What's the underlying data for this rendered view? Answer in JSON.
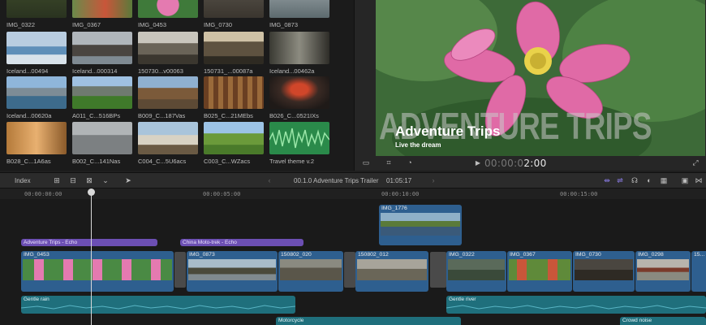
{
  "browser": {
    "clips": [
      {
        "label": "IMG_0322"
      },
      {
        "label": "IMG_0367"
      },
      {
        "label": "IMG_0453"
      },
      {
        "label": "IMG_0730"
      },
      {
        "label": "IMG_0873"
      },
      {
        "label": "Iceland...00494"
      },
      {
        "label": "Iceland...000314"
      },
      {
        "label": "150730...v00063"
      },
      {
        "label": "150731_...00087a"
      },
      {
        "label": "Iceland...00462a"
      },
      {
        "label": "Iceland...00620a"
      },
      {
        "label": "A011_C...516BPs"
      },
      {
        "label": "B009_C...187Vas"
      },
      {
        "label": "B025_C...21MEbs"
      },
      {
        "label": "B026_C...0521IXs"
      },
      {
        "label": "B028_C...1A6as"
      },
      {
        "label": "B002_C...141Nas"
      },
      {
        "label": "C004_C...5U6acs"
      },
      {
        "label": "C003_C...WZacs"
      },
      {
        "label": "Travel theme v.2"
      }
    ]
  },
  "viewer": {
    "title_text": "Adventure Trips",
    "subtitle_text": "Live the dream",
    "watermark_text": "ADVENTURE TRIPS",
    "timecode_dim": "00:00:0",
    "timecode_bright": "2:00",
    "play_glyph": "▶"
  },
  "toolbar": {
    "index_label": "Index",
    "project_title": "00.1.0 Adventure Trips Trailer",
    "duration": "01:05:17"
  },
  "timeline": {
    "ruler": [
      "00:00:00:00",
      "00:00:05:00",
      "00:00:10:00",
      "00:00:15:00"
    ],
    "connected_clip": "IMG_1776",
    "sound_effects": [
      "Adventure Trips - Echo",
      "China Moto-trek - Echo"
    ],
    "primary_clips": [
      "IMG_0453",
      "IMG_0873",
      "150802_020",
      "150802_012",
      "IMG_0322",
      "IMG_0367",
      "IMG_0730",
      "IMG_0298",
      "15..."
    ],
    "music": [
      "Gentle rain",
      "Gentle river",
      "Motorcycle",
      "Crowd noise"
    ]
  },
  "colors": {
    "accent_purple": "#6c4fb3",
    "music_teal": "#1f6f7c",
    "video_blue": "#2e5f8f"
  }
}
